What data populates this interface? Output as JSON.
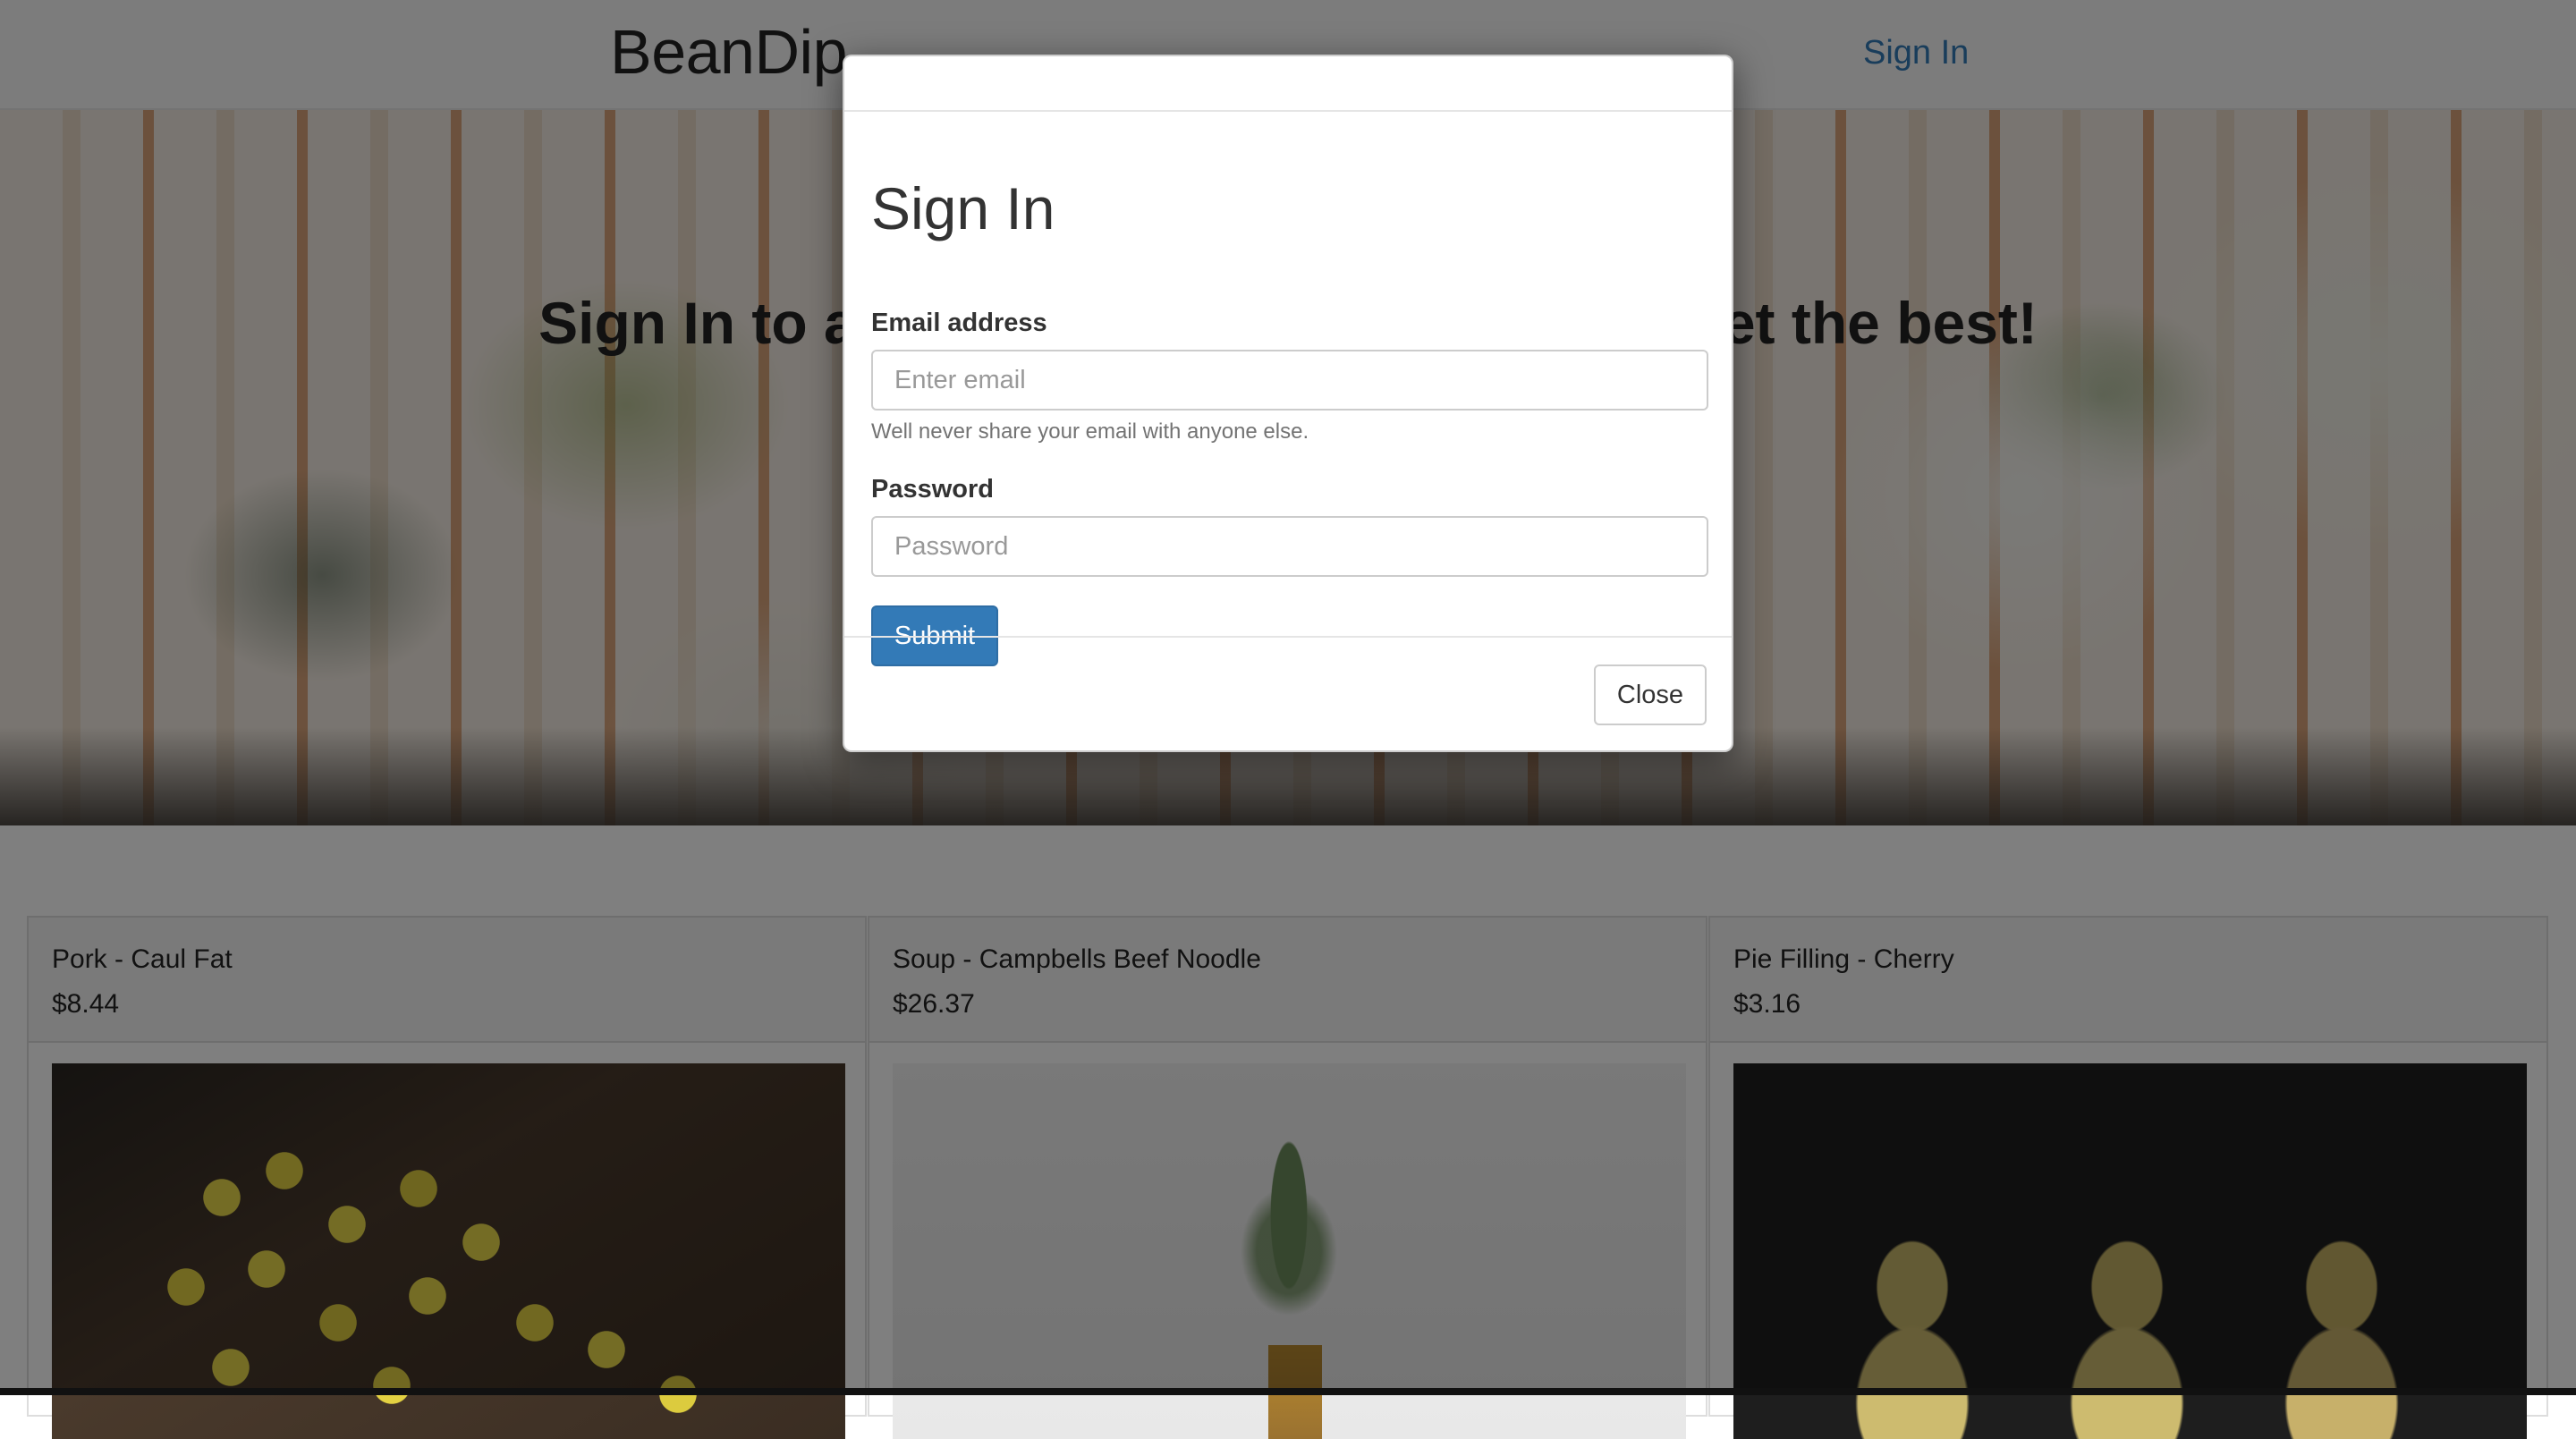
{
  "navbar": {
    "brand": "BeanDip",
    "sign_in_link": "Sign In"
  },
  "hero": {
    "title": "Sign In to add items to your wishlist and get the best!",
    "background_image": "food-table-photo"
  },
  "products": [
    {
      "name": "Pork - Caul Fat",
      "price": "$8.44",
      "image": "lemons-photo"
    },
    {
      "name": "Soup - Campbells Beef Noodle",
      "price": "$26.37",
      "image": "pineapple-photo"
    },
    {
      "name": "Pie Filling - Cherry",
      "price": "$3.16",
      "image": "pears-photo"
    }
  ],
  "modal": {
    "title": "Sign In",
    "email_label": "Email address",
    "email_placeholder": "Enter email",
    "email_value": "",
    "email_help": "Well never share your email with anyone else.",
    "password_label": "Password",
    "password_placeholder": "Password",
    "password_value": "",
    "submit_label": "Submit",
    "close_label": "Close"
  },
  "colors": {
    "primary": "#337ab7",
    "link": "#337ab7",
    "backdrop": "rgba(0,0,0,0.5)"
  }
}
